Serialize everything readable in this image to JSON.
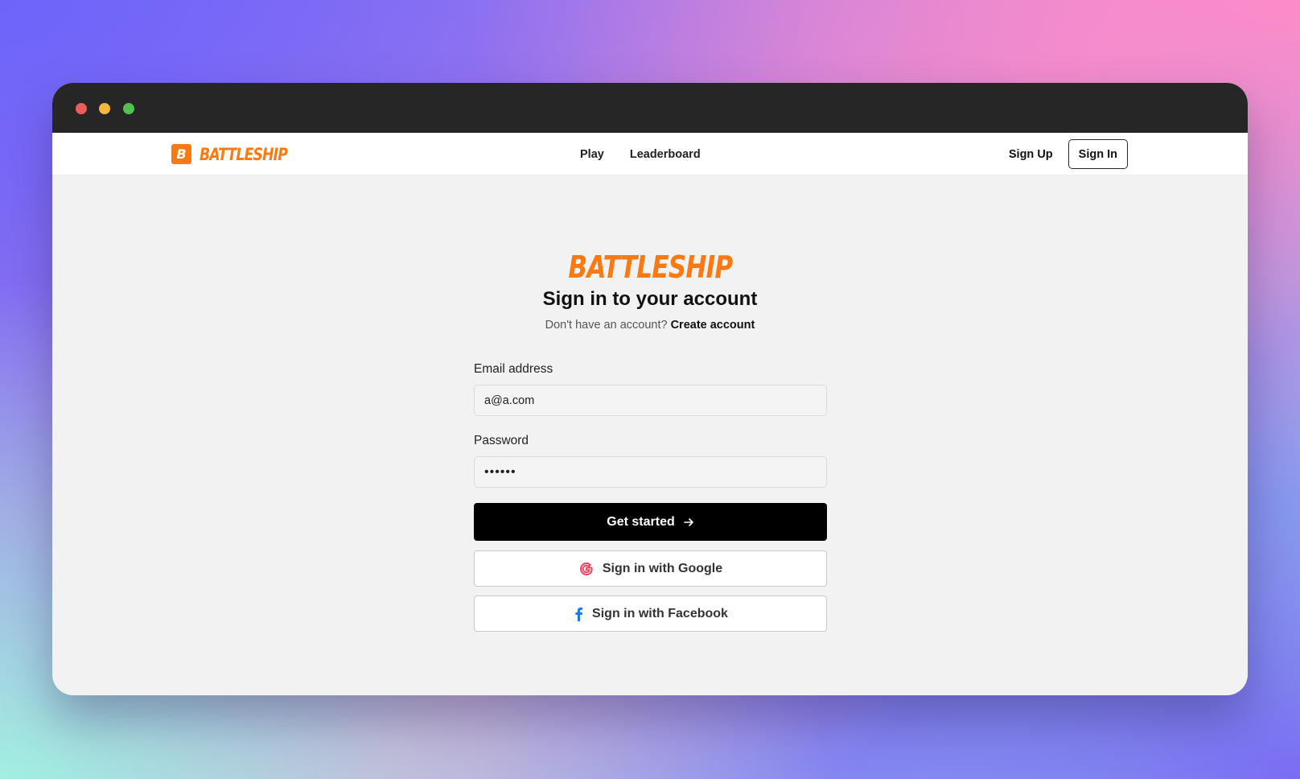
{
  "brand": {
    "badge_letter": "B",
    "name": "BATTLESHIP",
    "color": "#f97a12"
  },
  "nav": {
    "links": [
      {
        "label": "Play"
      },
      {
        "label": "Leaderboard"
      }
    ],
    "sign_up_label": "Sign Up",
    "sign_in_label": "Sign In"
  },
  "auth": {
    "logo_text": "BATTLESHIP",
    "title": "Sign in to your account",
    "subtitle_prompt": "Don't have an account?",
    "create_account_label": "Create account",
    "email": {
      "label": "Email address",
      "value": "a@a.com"
    },
    "password": {
      "label": "Password",
      "value": "••••••"
    },
    "submit_label": "Get started",
    "google_label": "Sign in with Google",
    "facebook_label": "Sign in with Facebook"
  },
  "icons": {
    "submit": "arrow-right-icon",
    "google": "google-icon",
    "facebook": "facebook-icon"
  },
  "colors": {
    "accent": "#f97a12",
    "google": "#f03f5f",
    "facebook": "#1877f2",
    "titlebar": "#262626"
  }
}
